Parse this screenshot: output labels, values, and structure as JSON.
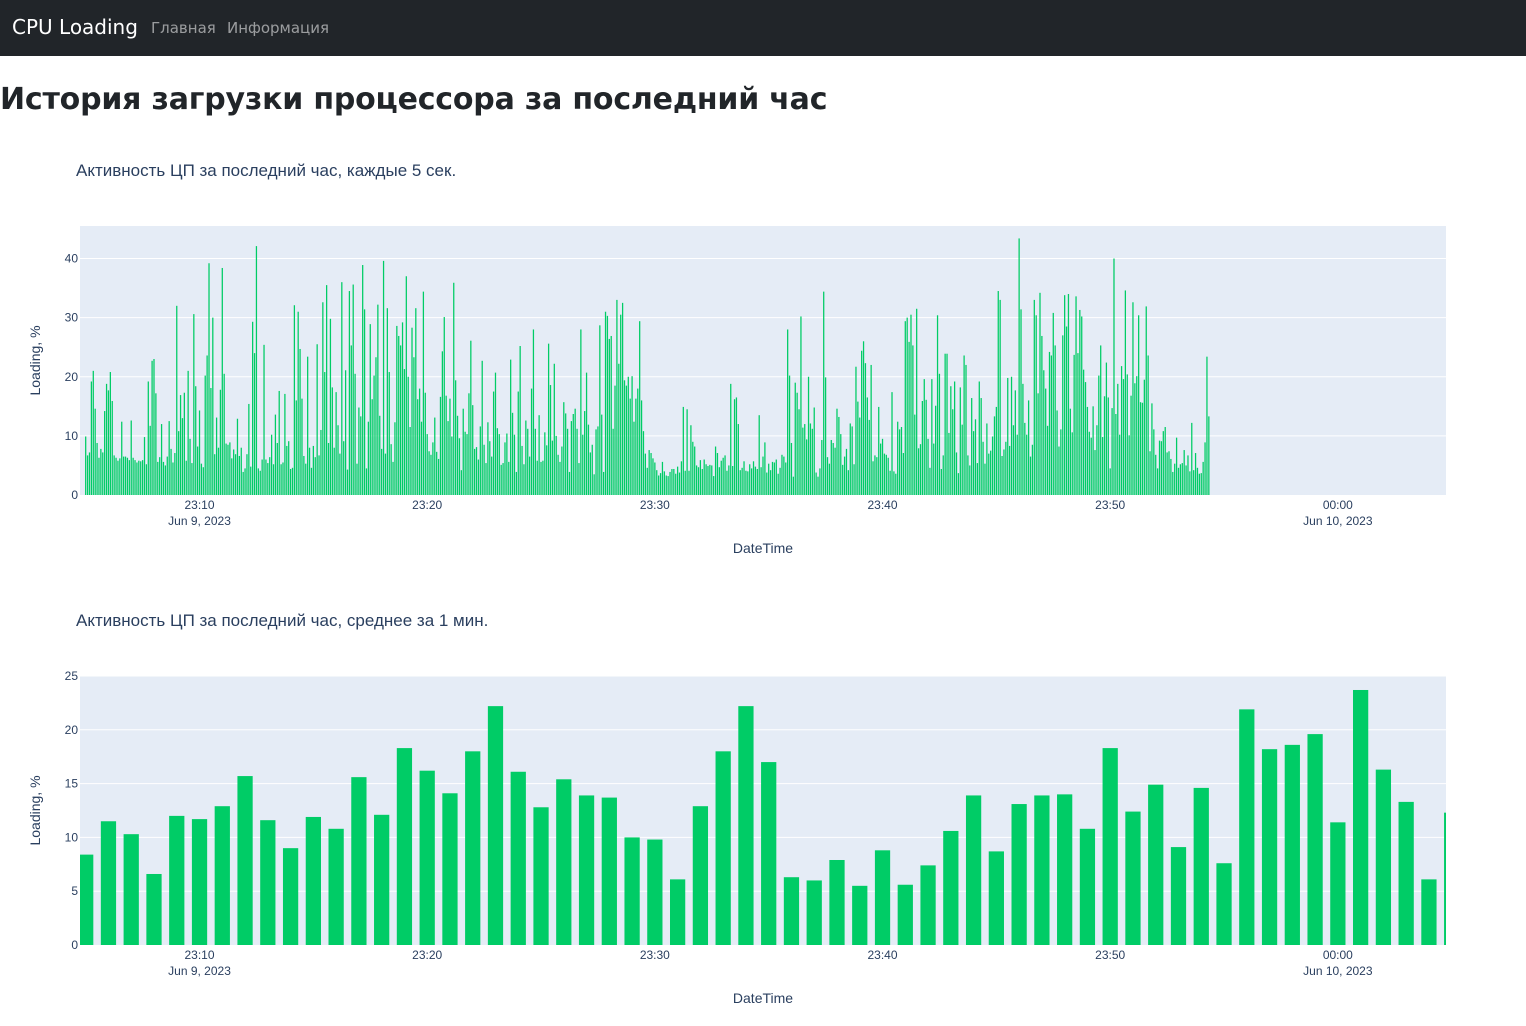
{
  "navbar": {
    "brand": "CPU Loading",
    "links": [
      "Главная",
      "Информация"
    ]
  },
  "page": {
    "title": "История загрузки процессора за последний час"
  },
  "colors": {
    "bar": "#00cc66",
    "plot_bg": "#e5ecf6",
    "grid": "#ffffff",
    "text": "#2a3f5f"
  },
  "chart_data": [
    {
      "type": "bar",
      "title": "Активность ЦП за последний час, каждые 5 сек.",
      "xlabel": "DateTime",
      "ylabel": "Loading, %",
      "xrange": [
        "2023-06-09 23:04:45",
        "2023-06-10 00:04:45"
      ],
      "ylim": [
        0,
        45.5
      ],
      "yticks": [
        0,
        10,
        20,
        30,
        40
      ],
      "xticks": [
        {
          "x": "2023-06-09 23:10:00",
          "label": "23:10",
          "sublabel": "Jun 9, 2023"
        },
        {
          "x": "2023-06-09 23:20:00",
          "label": "23:20",
          "sublabel": ""
        },
        {
          "x": "2023-06-09 23:30:00",
          "label": "23:30",
          "sublabel": ""
        },
        {
          "x": "2023-06-09 23:40:00",
          "label": "23:40",
          "sublabel": ""
        },
        {
          "x": "2023-06-09 23:50:00",
          "label": "23:50",
          "sublabel": ""
        },
        {
          "x": "2023-06-10 00:00:00",
          "label": "00:00",
          "sublabel": "Jun 10, 2023"
        }
      ],
      "x_start": "2023-06-09 23:05:00",
      "x_step_seconds": 5,
      "values": [
        9.9,
        6.7,
        7.2,
        19.2,
        21.0,
        14.6,
        8.8,
        6.3,
        7.8,
        7.2,
        14.2,
        18.8,
        17.7,
        20.8,
        15.9,
        6.7,
        6.3,
        5.8,
        6.2,
        12.4,
        6.5,
        6.5,
        6.3,
        5.9,
        12.6,
        6.3,
        5.9,
        5.5,
        5.8,
        5.7,
        5.9,
        9.8,
        5.2,
        19.2,
        11.7,
        22.7,
        23.0,
        17.2,
        5.6,
        6.4,
        12.0,
        5.6,
        5.0,
        6.5,
        12.5,
        7.8,
        5.5,
        7.1,
        32.0,
        10.8,
        16.9,
        13.0,
        17.3,
        5.8,
        21.0,
        9.5,
        5.4,
        30.6,
        18.4,
        8.2,
        14.3,
        5.3,
        4.7,
        20.2,
        23.6,
        39.2,
        18.1,
        30.0,
        6.9,
        13.1,
        8.0,
        17.8,
        38.4,
        20.5,
        8.7,
        8.5,
        8.9,
        6.2,
        7.7,
        6.9,
        12.9,
        6.6,
        8.0,
        3.9,
        4.5,
        6.9,
        15.4,
        4.8,
        29.3,
        24.0,
        42.1,
        4.5,
        4.1,
        6.0,
        25.4,
        6.0,
        5.4,
        6.4,
        10.2,
        5.2,
        13.6,
        8.8,
        17.6,
        5.2,
        5.5,
        17.1,
        8.3,
        9.1,
        4.4,
        4.6,
        32.1,
        16.0,
        31.0,
        24.7,
        16.3,
        6.6,
        5.3,
        23.4,
        8.0,
        4.6,
        8.3,
        6.4,
        25.5,
        6.7,
        11.0,
        32.6,
        20.8,
        35.5,
        8.8,
        29.8,
        18.2,
        8.0,
        17.4,
        11.8,
        7.0,
        36.0,
        9.1,
        21.1,
        4.3,
        34.5,
        25.3,
        35.6,
        20.5,
        5.3,
        14.8,
        13.3,
        38.9,
        31.4,
        4.5,
        12.4,
        28.9,
        16.2,
        20.2,
        23.3,
        32.2,
        13.4,
        7.8,
        39.6,
        7.0,
        31.6,
        20.8,
        8.6,
        5.6,
        12.3,
        28.6,
        26.9,
        25.3,
        29.2,
        21.3,
        37.0,
        20.0,
        11.5,
        28.3,
        23.3,
        31.6,
        16.2,
        18.0,
        12.4,
        34.4,
        17.3,
        10.3,
        7.4,
        6.8,
        8.9,
        13.1,
        7.3,
        6.1,
        16.6,
        24.3,
        30.1,
        16.8,
        12.5,
        16.3,
        9.9,
        35.9,
        19.4,
        13.4,
        9.6,
        4.2,
        14.6,
        10.7,
        10.3,
        17.2,
        26.1,
        15.2,
        7.8,
        8.1,
        6.0,
        11.6,
        22.7,
        8.5,
        5.4,
        12.3,
        9.1,
        6.5,
        17.5,
        20.7,
        11.3,
        10.3,
        5.1,
        5.4,
        8.9,
        10.4,
        5.6,
        22.9,
        13.9,
        10.2,
        3.9,
        17.5,
        25.2,
        8.3,
        5.2,
        12.6,
        11.2,
        6.5,
        18.0,
        28.0,
        11.2,
        5.8,
        13.5,
        5.6,
        5.8,
        10.6,
        8.4,
        25.6,
        18.6,
        9.2,
        22.2,
        10.0,
        6.8,
        5.6,
        8.2,
        15.7,
        13.8,
        11.2,
        3.9,
        12.5,
        13.7,
        14.6,
        11.2,
        5.4,
        28.0,
        10.2,
        14.2,
        20.7,
        11.9,
        7.2,
        8.5,
        3.5,
        11.1,
        11.6,
        28.7,
        13.6,
        3.9,
        31.0,
        30.3,
        26.4,
        26.9,
        11.2,
        18.5,
        33.0,
        22.2,
        30.5,
        32.5,
        19.4,
        18.5,
        20.0,
        16.3,
        20.1,
        12.4,
        16.3,
        18.0,
        29.4,
        16.0,
        10.8,
        7.0,
        4.6,
        7.6,
        7.1,
        6.2,
        5.5,
        4.2,
        3.3,
        3.7,
        5.6,
        4.0,
        3.3,
        3.2,
        3.9,
        4.4,
        4.4,
        3.6,
        4.8,
        3.8,
        5.7,
        14.9,
        4.1,
        14.5,
        4.1,
        11.8,
        9.0,
        8.2,
        5.0,
        4.7,
        5.9,
        4.4,
        6.0,
        5.2,
        4.9,
        5.1,
        5.0,
        3.2,
        8.2,
        7.1,
        4.7,
        5.8,
        6.3,
        6.7,
        4.1,
        5.0,
        18.8,
        4.9,
        16.2,
        16.5,
        12.0,
        4.2,
        4.6,
        5.7,
        4.1,
        4.0,
        5.2,
        4.5,
        5.7,
        4.8,
        4.4,
        13.5,
        4.7,
        6.5,
        8.9,
        3.8,
        5.3,
        4.2,
        5.6,
        5.5,
        6.0,
        3.6,
        4.6,
        6.8,
        6.5,
        5.5,
        28.0,
        20.2,
        8.8,
        3.1,
        19.0,
        17.3,
        14.5,
        30.2,
        11.4,
        12.0,
        9.4,
        20.0,
        12.1,
        11.2,
        14.8,
        3.8,
        3.1,
        4.5,
        9.3,
        34.4,
        19.9,
        6.4,
        5.3,
        9.3,
        8.8,
        8.0,
        14.6,
        13.2,
        10.3,
        5.1,
        6.5,
        7.8,
        4.2,
        12.1,
        11.6,
        5.2,
        21.7,
        15.8,
        13.1,
        24.4,
        26.0,
        22.3,
        16.5,
        12.7,
        22.0,
        5.7,
        6.7,
        6.4,
        14.9,
        8.7,
        9.5,
        7.0,
        6.8,
        6.3,
        4.1,
        17.4,
        4.0,
        3.6,
        12.4,
        11.1,
        11.5,
        7.1,
        29.4,
        30.0,
        25.9,
        30.5,
        25.3,
        13.6,
        31.5,
        7.9,
        8.6,
        15.9,
        19.6,
        16.1,
        9.5,
        4.6,
        19.6,
        8.7,
        15.1,
        30.4,
        20.5,
        4.4,
        6.7,
        23.9,
        23.9,
        10.5,
        18.4,
        14.5,
        19.2,
        7.2,
        3.7,
        18.2,
        11.9,
        23.6,
        22.0,
        6.7,
        5.0,
        16.4,
        10.8,
        12.8,
        5.4,
        19.2,
        16.4,
        9.0,
        5.3,
        12.1,
        7.0,
        7.5,
        9.9,
        13.3,
        14.9,
        34.5,
        33.0,
        6.6,
        7.7,
        9.0,
        19.8,
        8.3,
        20.0,
        11.8,
        17.7,
        10.2,
        43.4,
        31.4,
        18.8,
        12.2,
        10.2,
        16.0,
        6.5,
        8.5,
        33.0,
        30.4,
        17.2,
        34.2,
        26.9,
        21.1,
        18.0,
        11.7,
        24.2,
        23.6,
        30.8,
        25.3,
        14.3,
        8.2,
        11.1,
        27.0,
        33.8,
        28.5,
        34.0,
        14.6,
        10.6,
        23.7,
        33.6,
        24.0,
        31.3,
        30.2,
        21.2,
        19.1,
        14.9,
        10.7,
        9.7,
        15.0,
        7.6,
        11.8,
        20.2,
        25.3,
        9.8,
        16.7,
        22.4,
        16.5,
        4.5,
        14.7,
        40.0,
        13.7,
        18.8,
        10.2,
        21.8,
        19.6,
        34.6,
        20.4,
        10.1,
        16.8,
        32.6,
        18.9,
        20.1,
        30.4,
        15.7,
        15.6,
        19.5,
        31.9,
        23.6,
        7.4,
        15.5,
        11.1,
        6.8,
        4.5,
        9.2,
        9.1,
        10.8,
        11.5,
        7.2,
        7.4,
        6.1,
        3.9,
        5.3,
        9.7,
        4.6,
        5.2,
        5.4,
        7.6,
        5.0,
        6.7,
        4.0,
        12.2,
        4.2,
        7.1,
        4.6,
        3.6,
        3.7,
        5.6,
        8.9,
        23.4,
        13.3
      ]
    },
    {
      "type": "bar",
      "title": "Активность ЦП за последний час, среднее за 1 мин.",
      "xlabel": "DateTime",
      "ylabel": "Loading, %",
      "xrange": [
        "2023-06-09 23:04:45",
        "2023-06-10 00:04:45"
      ],
      "ylim": [
        0,
        25
      ],
      "yticks": [
        0,
        5,
        10,
        15,
        20,
        25
      ],
      "xticks": [
        {
          "x": "2023-06-09 23:10:00",
          "label": "23:10",
          "sublabel": "Jun 9, 2023"
        },
        {
          "x": "2023-06-09 23:20:00",
          "label": "23:20",
          "sublabel": ""
        },
        {
          "x": "2023-06-09 23:30:00",
          "label": "23:30",
          "sublabel": ""
        },
        {
          "x": "2023-06-09 23:40:00",
          "label": "23:40",
          "sublabel": ""
        },
        {
          "x": "2023-06-09 23:50:00",
          "label": "23:50",
          "sublabel": ""
        },
        {
          "x": "2023-06-10 00:00:00",
          "label": "00:00",
          "sublabel": "Jun 10, 2023"
        }
      ],
      "x_start": "2023-06-09 23:05:00",
      "x_step_seconds": 60,
      "values": [
        8.4,
        11.5,
        10.3,
        6.6,
        12.0,
        11.7,
        12.9,
        15.7,
        11.6,
        9.0,
        11.9,
        10.8,
        15.6,
        12.1,
        18.3,
        16.2,
        14.1,
        18.0,
        22.2,
        16.1,
        12.8,
        15.4,
        13.9,
        13.7,
        10.0,
        9.8,
        6.1,
        12.9,
        18.0,
        22.2,
        17.0,
        6.3,
        6.0,
        7.9,
        5.5,
        8.8,
        5.6,
        7.4,
        10.6,
        13.9,
        8.7,
        13.1,
        13.9,
        14.0,
        10.8,
        18.3,
        12.4,
        14.9,
        9.1,
        14.6,
        7.6,
        21.9,
        18.2,
        18.6,
        19.6,
        11.4,
        23.7,
        16.3,
        13.3,
        6.1,
        12.3
      ]
    }
  ]
}
